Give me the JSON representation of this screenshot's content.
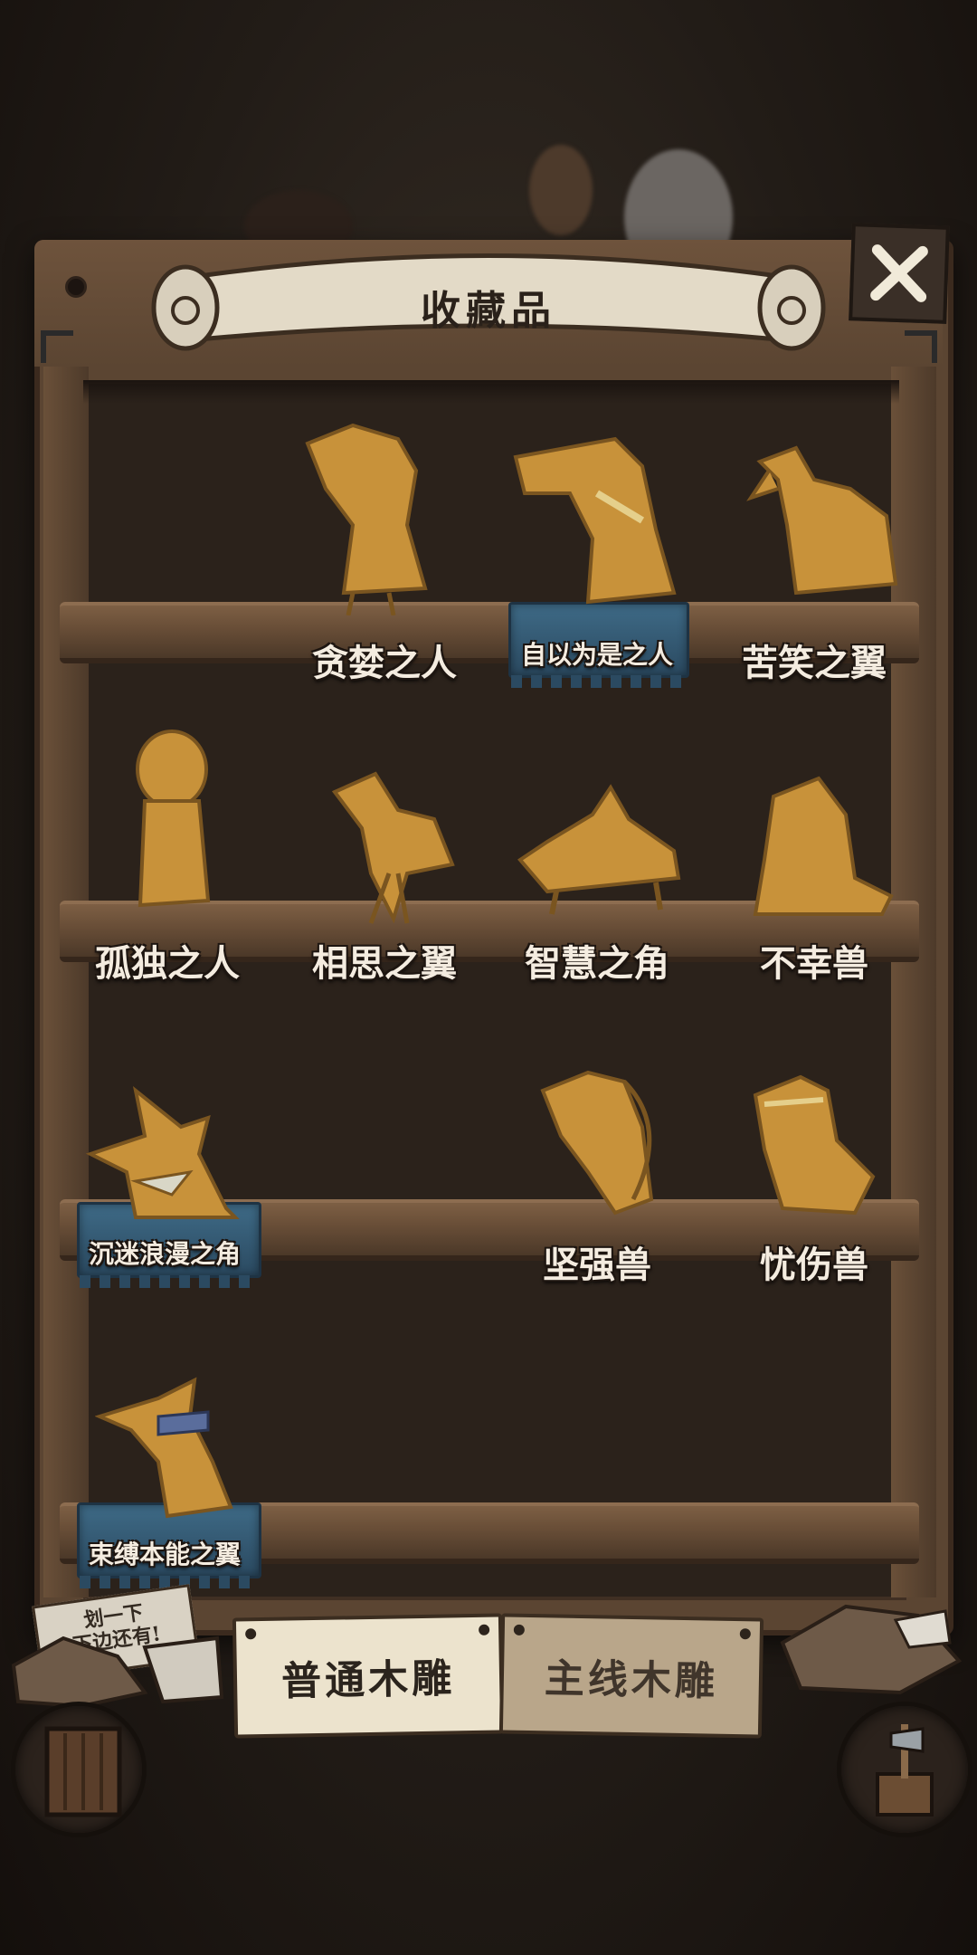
{
  "window": {
    "title": "收藏品"
  },
  "close": {
    "icon": "close-x-icon"
  },
  "hint": {
    "line1": "划一下",
    "line2": "下边还有!"
  },
  "shelves": [
    {
      "items": [
        {
          "label": "贪婪之人",
          "icon": "greedy-man-figurine",
          "plaque": false
        },
        {
          "label": "自以为是之人",
          "icon": "arrogant-man-figurine",
          "plaque": true
        },
        {
          "label": "苦笑之翼",
          "icon": "bitter-smile-wing-figurine",
          "plaque": false
        }
      ]
    },
    {
      "items": [
        {
          "label": "孤独之人",
          "icon": "lonely-person-figurine",
          "plaque": false
        },
        {
          "label": "相思之翼",
          "icon": "longing-wing-figurine",
          "plaque": false
        },
        {
          "label": "智慧之角",
          "icon": "wisdom-horn-figurine",
          "plaque": false
        },
        {
          "label": "不幸兽",
          "icon": "unlucky-beast-figurine",
          "plaque": false
        }
      ]
    },
    {
      "items": [
        {
          "label": "沉迷浪漫之角",
          "icon": "romance-horn-figurine",
          "plaque": true
        },
        {
          "label": "坚强兽",
          "icon": "strong-beast-figurine",
          "plaque": false
        },
        {
          "label": "忧伤兽",
          "icon": "sad-beast-figurine",
          "plaque": false
        }
      ]
    },
    {
      "items": [
        {
          "label": "束缚本能之翼",
          "icon": "bound-instinct-wing-figurine",
          "plaque": true
        }
      ]
    }
  ],
  "tabs": {
    "normal": "普通木雕",
    "main": "主线木雕",
    "active": "normal"
  },
  "colors": {
    "plaque": "#2f5068",
    "wood": "#5b4532",
    "figurine": "#c8923a"
  }
}
